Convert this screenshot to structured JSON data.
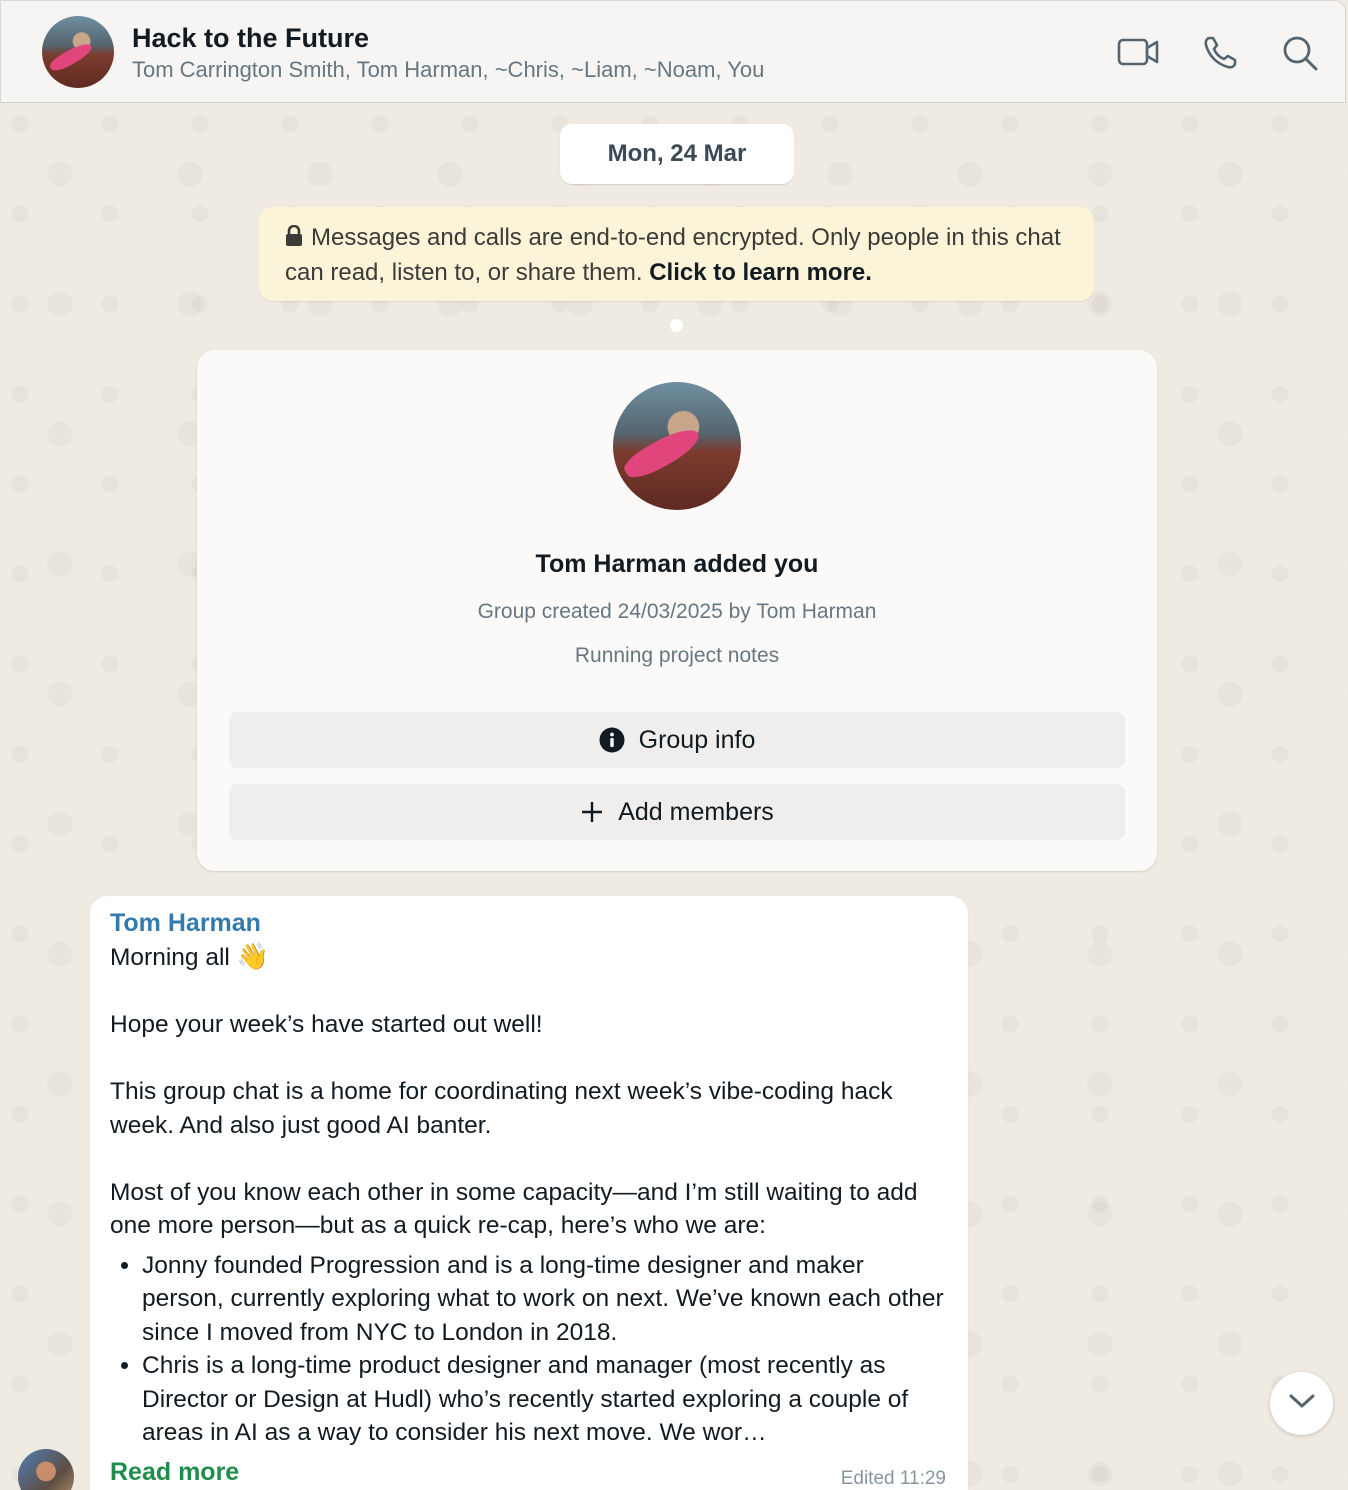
{
  "header": {
    "title": "Hack to the Future",
    "participants": "Tom Carrington Smith, Tom Harman, ~Chris, ~Liam, ~Noam, You",
    "icons": [
      "video-call-icon",
      "phone-icon",
      "search-icon"
    ]
  },
  "date_chip": "Mon, 24 Mar",
  "encryption_notice": {
    "text": "Messages and calls are end-to-end encrypted. Only people in this chat can read, listen to, or share them.",
    "link": "Click to learn more."
  },
  "group_card": {
    "title": "Tom Harman added you",
    "created": "Group created 24/03/2025 by Tom Harman",
    "description": "Running project notes",
    "group_info_label": "Group info",
    "add_members_label": "Add members"
  },
  "message": {
    "sender": "Tom Harman",
    "line1": "Morning all",
    "emoji": "👋",
    "para1": "Hope your week’s have started out well!",
    "para2": "This group chat is a home for coordinating next week’s vibe-coding hack week. And also just good AI banter.",
    "para3": "Most of you know each other in some capacity—and I’m still waiting to add one more person—but as a quick re-cap, here’s who we are:",
    "bullets": [
      "Jonny founded Progression and is a long-time designer and maker person, currently exploring what to work on next. We’ve known each other since I moved from NYC to London in 2018.",
      "Chris is a long-time product designer and manager (most recently as Director or Design at Hudl) who’s recently started exploring a couple of areas in AI as a way to consider his next move. We wor…"
    ],
    "read_more": "Read more",
    "meta": "Edited  11:29"
  },
  "colors": {
    "sender": "#357aad",
    "read_more": "#1f8d4b",
    "encryption_bg": "#fcf4d9",
    "chat_bg": "#efeae2"
  }
}
